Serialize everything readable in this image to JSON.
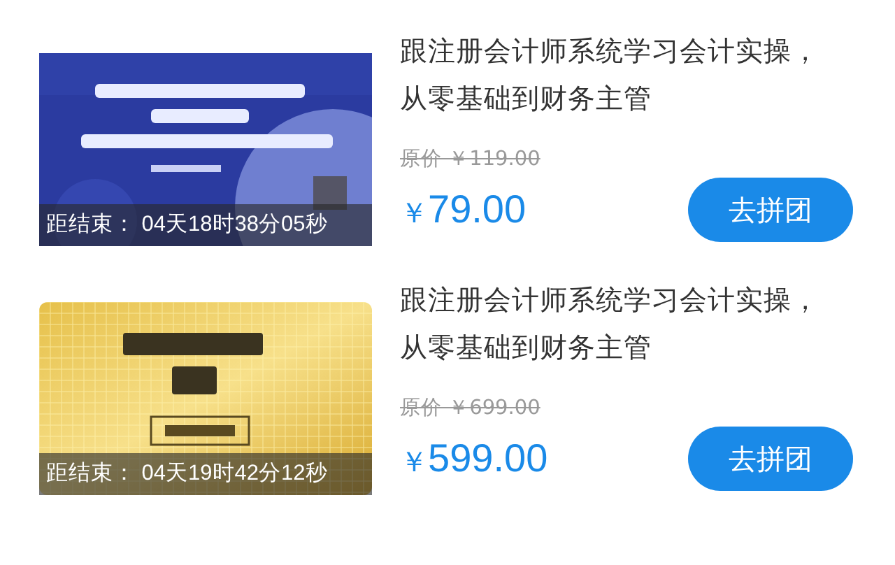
{
  "products": [
    {
      "countdown": "距结束： 04天18时38分05秒",
      "title": "跟注册会计师系统学习会计实操，从零基础到财务主管",
      "original_price": "原价 ￥119.00",
      "currency": "￥",
      "price": "79.00",
      "button": "去拼团"
    },
    {
      "countdown": "距结束： 04天19时42分12秒",
      "title": "跟注册会计师系统学习会计实操，从零基础到财务主管",
      "original_price": "原价 ￥699.00",
      "currency": "￥",
      "price": "599.00",
      "button": "去拼团"
    }
  ]
}
